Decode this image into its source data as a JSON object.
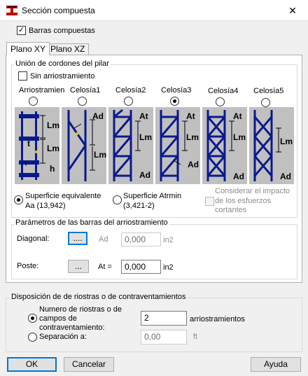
{
  "window": {
    "title": "Sección compuesta",
    "close": "✕"
  },
  "barras_compuestas": {
    "label": "Barras compuestas",
    "checked": true
  },
  "tabs": [
    {
      "label": "Plano XY",
      "active": true
    },
    {
      "label": "Plano XZ",
      "active": false
    }
  ],
  "union": {
    "title": "Unión de cordones del pilar",
    "sin_arriostramiento": "Sin arriostramiento",
    "options": [
      {
        "label": "Arriostramien",
        "selected": false
      },
      {
        "label": "Celosía1",
        "selected": false
      },
      {
        "label": "Celosía2",
        "selected": false
      },
      {
        "label": "Celosía3",
        "selected": true
      },
      {
        "label": "Celosía4",
        "selected": false
      },
      {
        "label": "Celosía5",
        "selected": false
      }
    ],
    "diagram_labels": {
      "lm": "Lm",
      "t": "t",
      "h": "h",
      "ad": "Ad",
      "at": "At"
    },
    "sup_equiv": {
      "label": "Superficie equivalente",
      "value": "Aa   (13,942)",
      "selected": true
    },
    "sup_atrmin": {
      "label": "Superficie Atrmin",
      "value": "(3,421-2)",
      "selected": false
    },
    "considerar": {
      "line1": "Considerar el impacto",
      "line2": "de los esfuerzos",
      "line3": "cortantes"
    }
  },
  "parametros": {
    "title": "Parámetros de las barras del arriostramiento",
    "diagonal": {
      "label": "Diagonal:",
      "button": "....",
      "field_label": "Ad",
      "value": "0,000",
      "unit": "in2"
    },
    "poste": {
      "label": "Poste:",
      "button": "...",
      "field_label": "At =",
      "value": "0,000",
      "unit": "in2"
    }
  },
  "disposicion": {
    "title": "Disposición de de riostras o de contraventamientos",
    "numero": {
      "line1": "Numero de riostras o de",
      "line2": "campos de",
      "line3": "contraventamiento:",
      "value": "2",
      "unit": "arriostramientos",
      "selected": true
    },
    "separacion": {
      "label": "Separación a:",
      "value": "0,00",
      "unit": "ft",
      "selected": false
    }
  },
  "buttons": {
    "ok": "OK",
    "cancel": "Cancelar",
    "help": "Ayuda"
  },
  "colors": {
    "brace_blue": "#0a1a8c",
    "diagram_bg": "#c0c0c0",
    "focus_blue": "#0078d7"
  }
}
